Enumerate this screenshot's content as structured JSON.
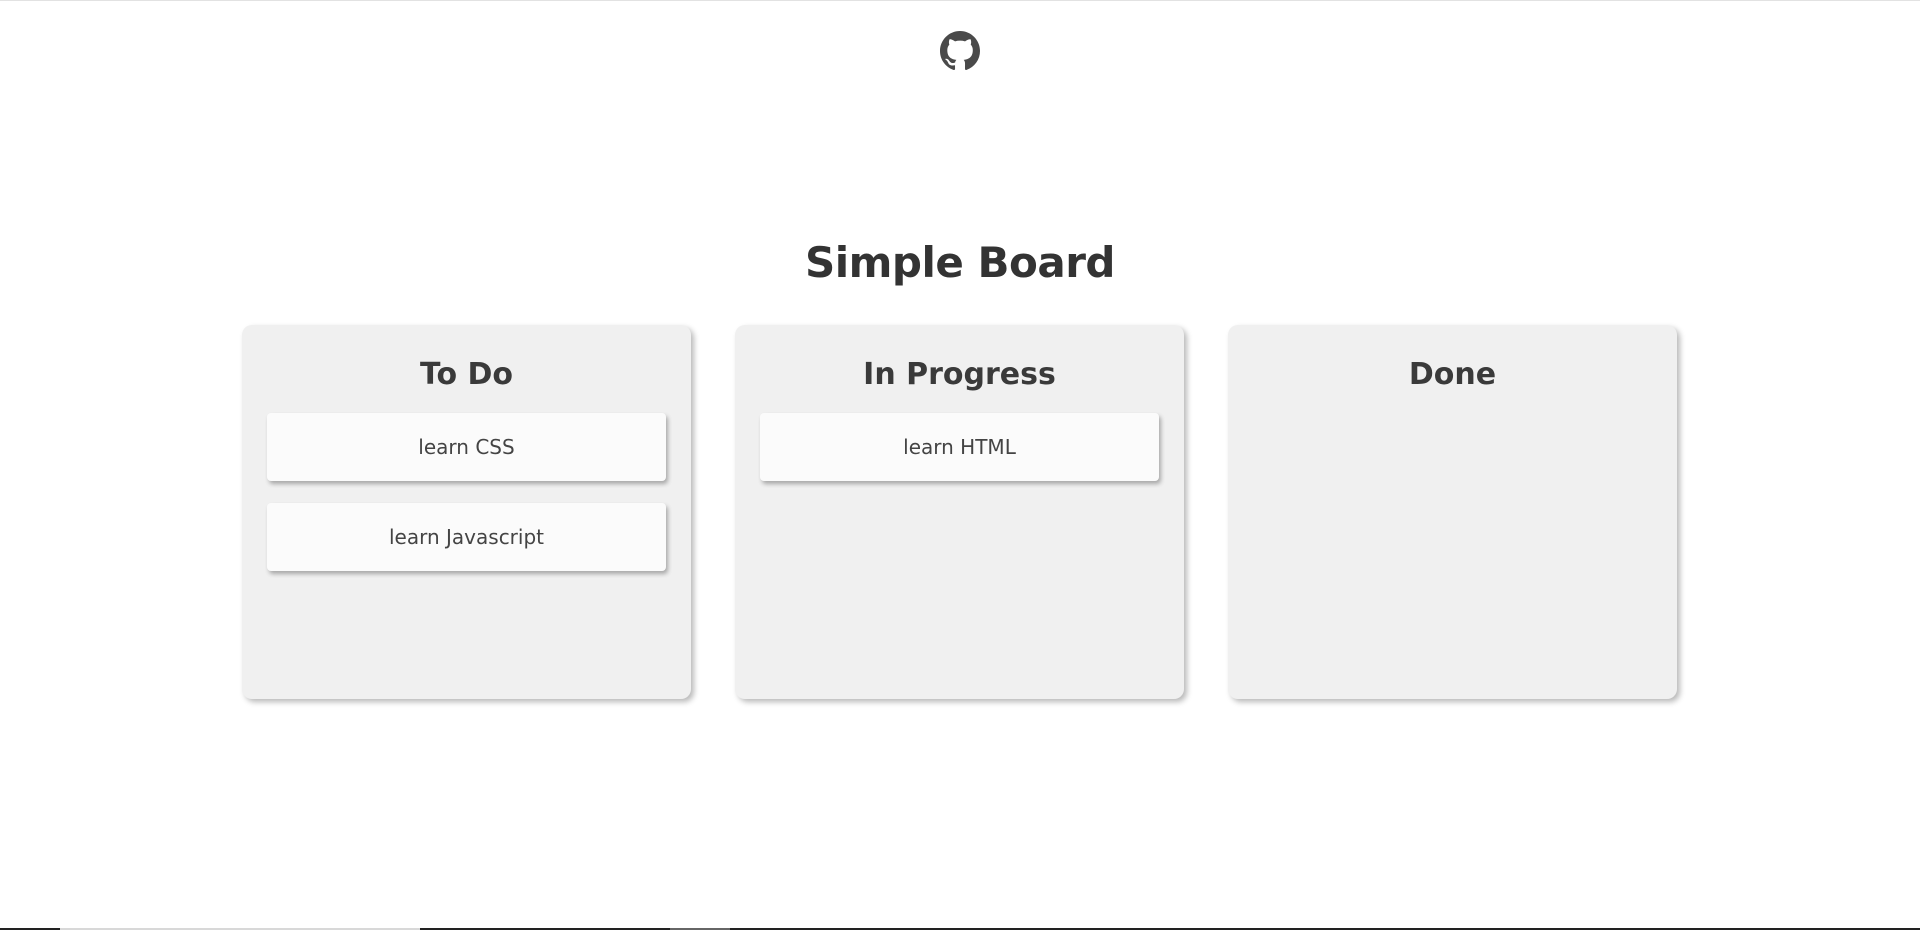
{
  "header": {
    "github_icon": "github-icon"
  },
  "page_title": "Simple Board",
  "columns": [
    {
      "title": "To Do",
      "cards": [
        "learn CSS",
        "learn Javascript"
      ]
    },
    {
      "title": "In Progress",
      "cards": [
        "learn HTML"
      ]
    },
    {
      "title": "Done",
      "cards": []
    }
  ],
  "colors": {
    "background": "#ffffff",
    "column_background": "#f0f0f0",
    "card_background": "#fbfbfb",
    "text": "#333333"
  }
}
